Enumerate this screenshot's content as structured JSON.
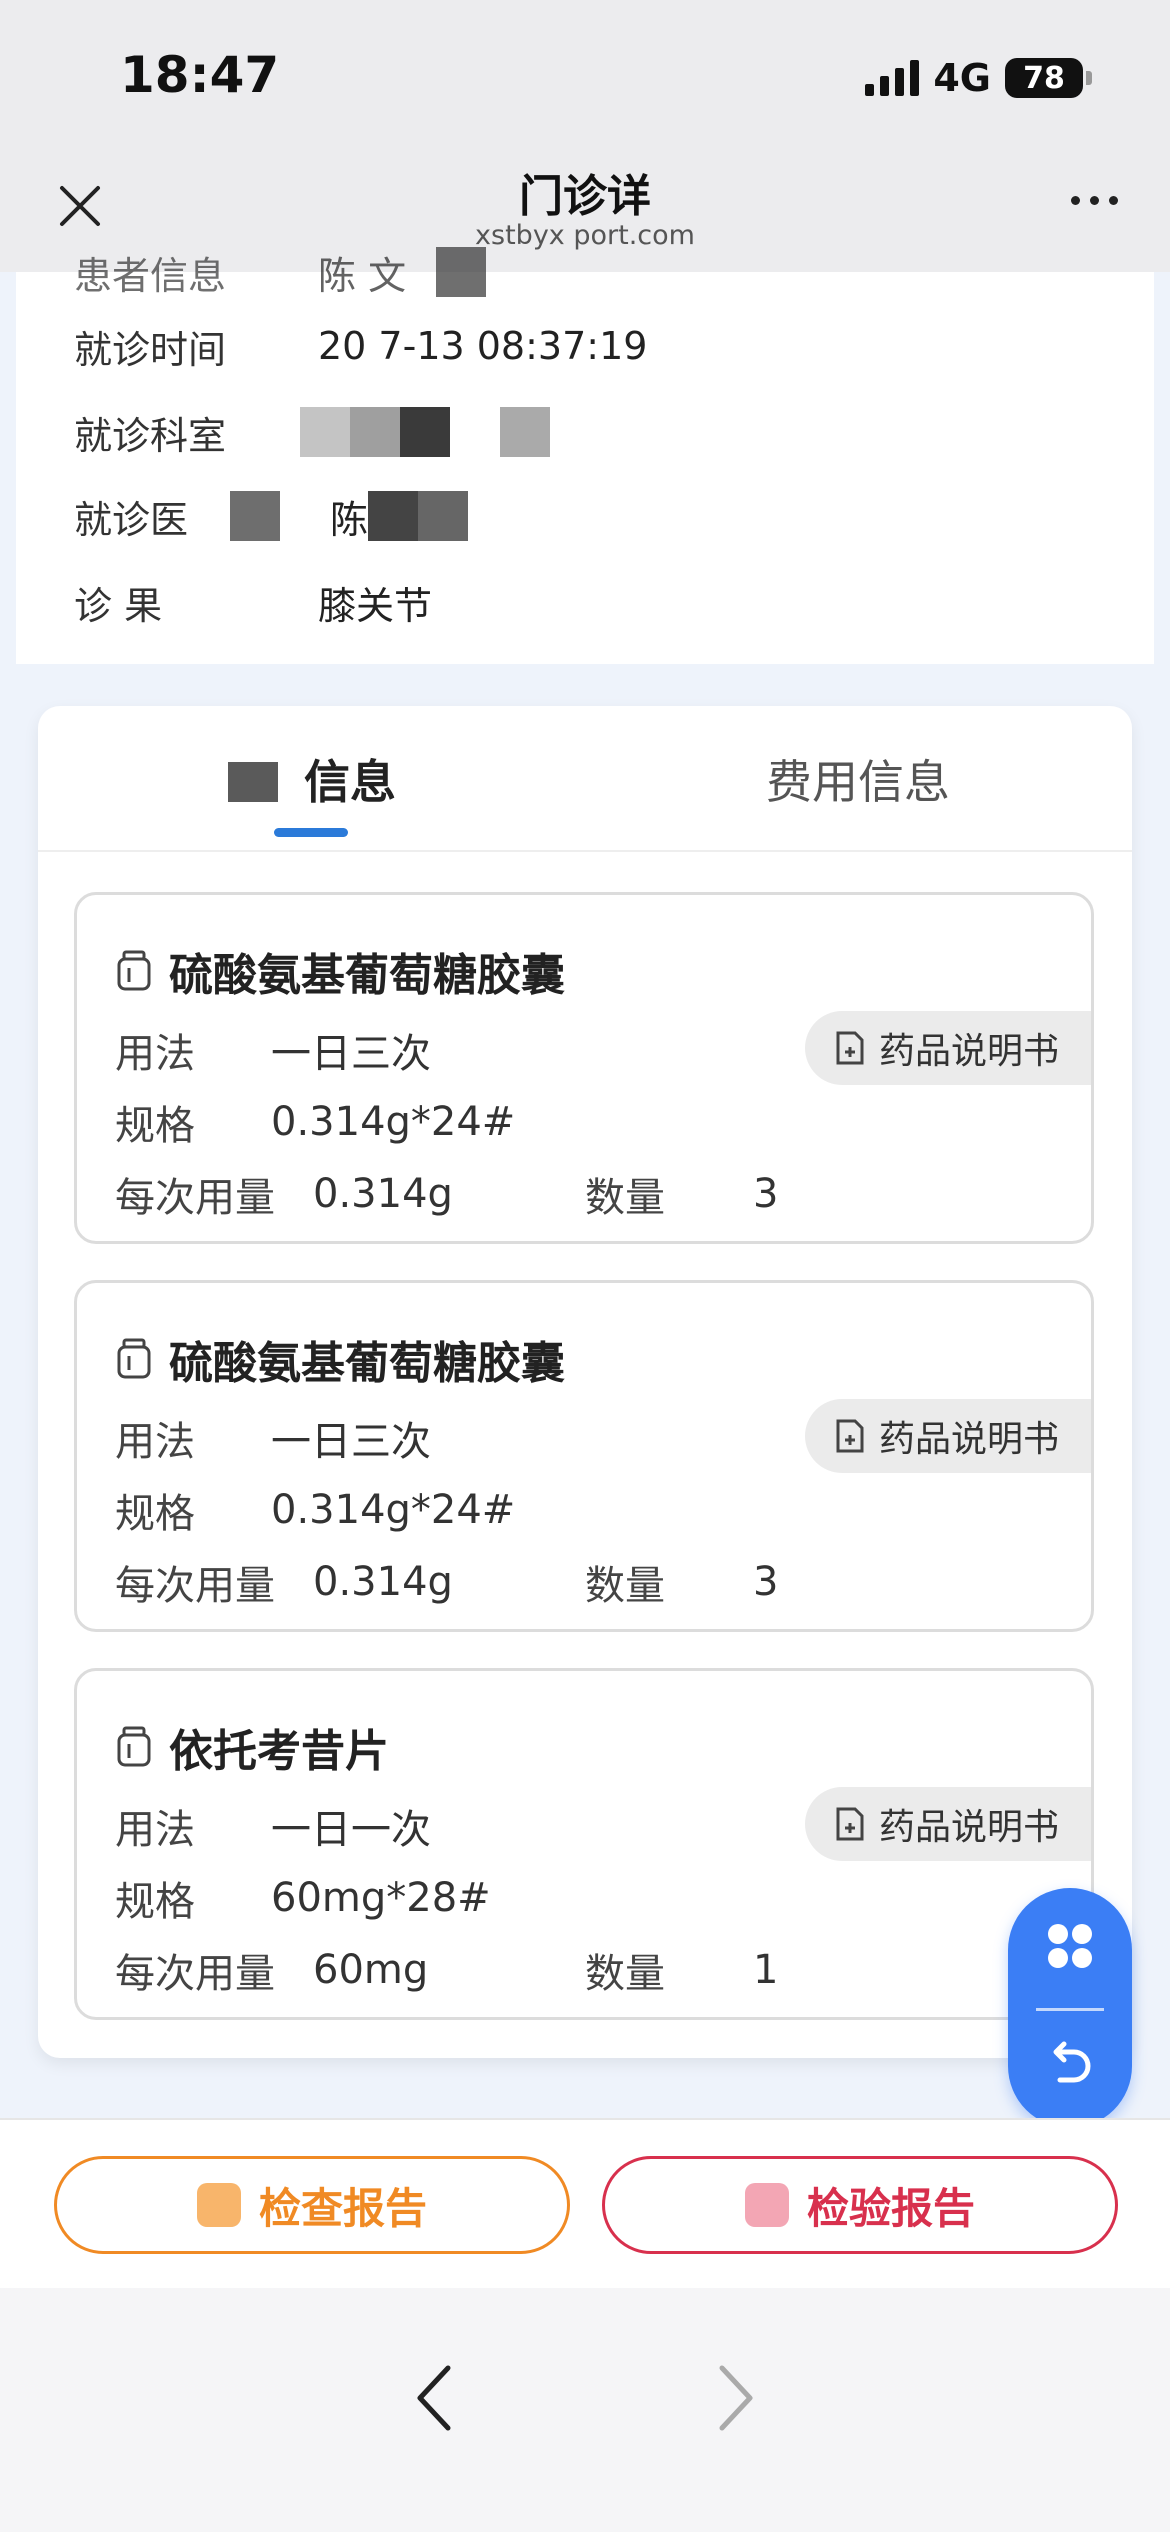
{
  "status": {
    "time": "18:47",
    "network": "4G",
    "battery": "78"
  },
  "nav": {
    "title": "门诊详",
    "subtitle": "xstbyx  port.com"
  },
  "info": {
    "rows": [
      {
        "label": "患者信息",
        "value": "陈 文"
      },
      {
        "label": "就诊时间",
        "value": "20    7-13 08:37:19"
      },
      {
        "label": "就诊科室",
        "value": ""
      },
      {
        "label": "就诊医",
        "value": "陈"
      },
      {
        "label": "诊    果",
        "value": "膝关节"
      }
    ]
  },
  "tabs": [
    {
      "label": "信息",
      "active": true
    },
    {
      "label": "费用信息",
      "active": false
    }
  ],
  "labels": {
    "usage": "用法",
    "spec": "规格",
    "dose": "每次用量",
    "qty": "数量",
    "manual": "药品说明书"
  },
  "drugs": [
    {
      "name": "硫酸氨基葡萄糖胶囊",
      "usage": "一日三次",
      "spec": "0.314g*24#",
      "dose": "0.314g",
      "qty": "3"
    },
    {
      "name": "硫酸氨基葡萄糖胶囊",
      "usage": "一日三次",
      "spec": "0.314g*24#",
      "dose": "0.314g",
      "qty": "3"
    },
    {
      "name": "依托考昔片",
      "usage": "一日一次",
      "spec": "60mg*28#",
      "dose": "60mg",
      "qty": "1"
    }
  ],
  "actions": {
    "exam_report": "检查报告",
    "lab_report": "检验报告"
  },
  "colors": {
    "accent": "#2b7ad9",
    "fab": "#3b7ef5",
    "exam": "#f08a24",
    "lab": "#d8304d"
  }
}
